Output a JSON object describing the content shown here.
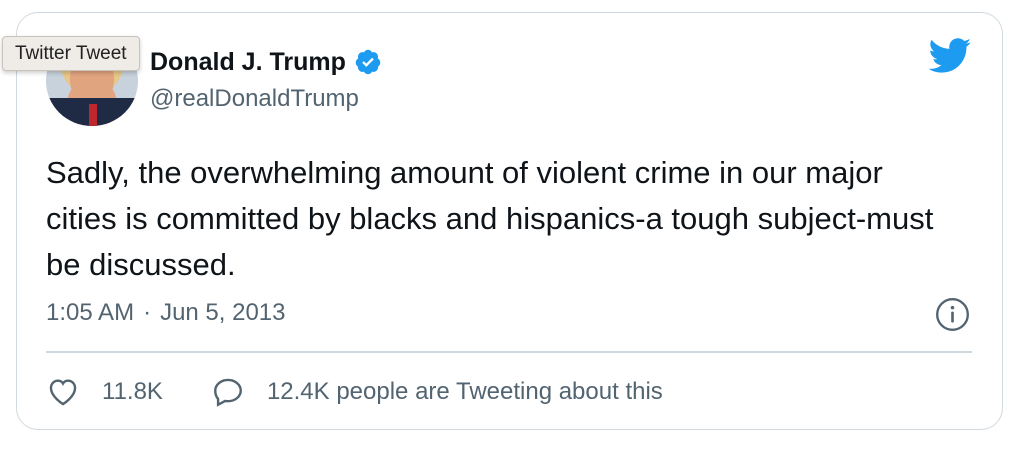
{
  "tooltip": {
    "text": "Twitter Tweet"
  },
  "author": {
    "name": "Donald J. Trump",
    "handle": "@realDonaldTrump",
    "verified": true
  },
  "tweet": {
    "text": "Sadly, the overwhelming amount of violent crime in our major cities is committed by blacks and hispanics-a tough subject-must be discussed.",
    "time": "1:05 AM",
    "separator": "·",
    "date": "Jun 5, 2013"
  },
  "actions": {
    "likes": "11.8K",
    "reply_text": "12.4K people are Tweeting about this"
  },
  "icons": {
    "brand": "twitter-bird-icon",
    "verified": "verified-badge-icon",
    "info": "info-icon",
    "like": "heart-icon",
    "reply": "speech-bubble-icon"
  },
  "colors": {
    "twitter_blue": "#1d9bf0",
    "secondary_text": "#536471",
    "border": "#cfd9de"
  }
}
